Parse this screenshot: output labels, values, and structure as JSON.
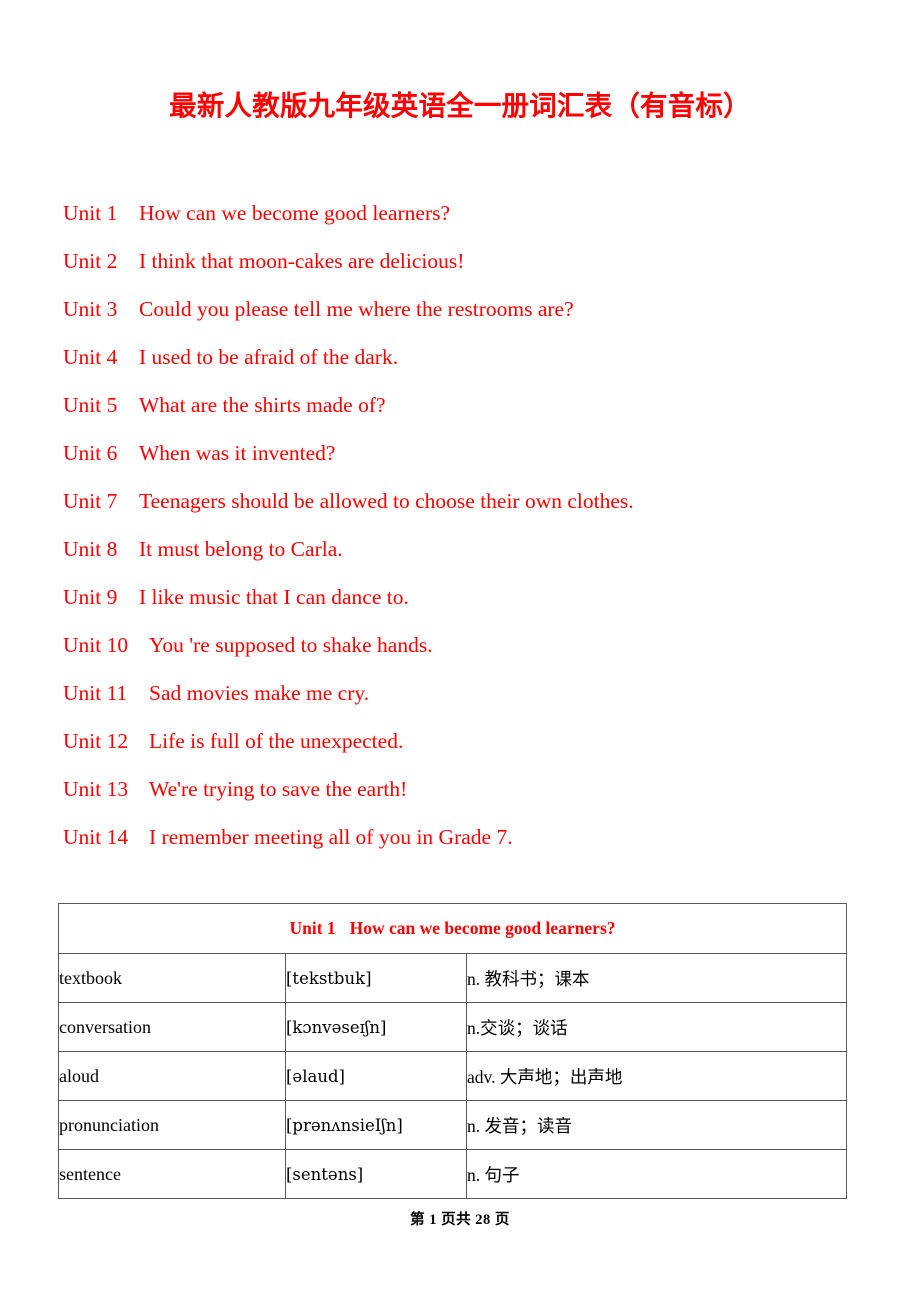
{
  "document": {
    "title": "最新人教版九年级英语全一册词汇表（有音标）",
    "title_color": "#ff0000",
    "text_color": "#000000"
  },
  "unit_list": [
    {
      "label": "Unit 1",
      "title": "How can we become good learners?"
    },
    {
      "label": "Unit 2",
      "title": "I think that moon-cakes are delicious!"
    },
    {
      "label": "Unit 3",
      "title": "Could you please tell me where the restrooms are?"
    },
    {
      "label": "Unit 4",
      "title": "I used to be afraid of the dark."
    },
    {
      "label": "Unit 5",
      "title": "What are the shirts made of?"
    },
    {
      "label": "Unit 6",
      "title": "When was it invented?"
    },
    {
      "label": "Unit 7",
      "title": "Teenagers should be allowed to choose their own clothes."
    },
    {
      "label": "Unit 8",
      "title": "It must belong to Carla."
    },
    {
      "label": "Unit 9",
      "title": "I like music that I can dance to."
    },
    {
      "label": "Unit 10",
      "title": "You 're supposed to shake hands."
    },
    {
      "label": "Unit 11",
      "title": "Sad movies make me cry."
    },
    {
      "label": "Unit 12",
      "title": "Life is full of the unexpected."
    },
    {
      "label": "Unit 13",
      "title": "We're trying to save the earth!"
    },
    {
      "label": "Unit 14",
      "title": "I remember meeting all of you in Grade 7."
    }
  ],
  "vocab_table": {
    "header": {
      "unit": "Unit 1",
      "title": "How can we become good learners?",
      "color": "#ff0000"
    },
    "rows": [
      {
        "word": "textbook",
        "phonetic": "[tekstbuk]",
        "definition": "n. 教科书；课本"
      },
      {
        "word": "conversation",
        "phonetic": "[kɔnvəseɪʃn]",
        "definition": "n.交谈；谈话"
      },
      {
        "word": "aloud",
        "phonetic": "[əlaud]",
        "definition": "adv. 大声地；出声地"
      },
      {
        "word": "pronunciation",
        "phonetic": "[prənʌnsieIʃn]",
        "definition": "n. 发音；读音"
      },
      {
        "word": "sentence",
        "phonetic": "[sentəns]",
        "definition": "n. 句子"
      }
    ]
  },
  "footer": {
    "text": "第 1 页共 28 页"
  }
}
